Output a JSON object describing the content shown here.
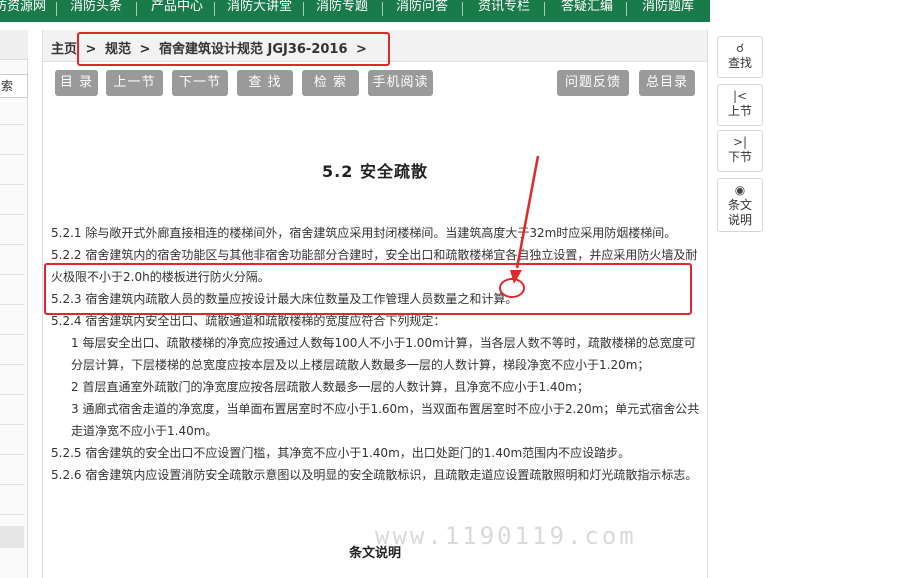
{
  "topnav": {
    "items": [
      "防资源网",
      "消防头条",
      "产品中心",
      "消防大讲堂",
      "消防专题",
      "消防问答",
      "资讯专栏",
      "答疑汇编",
      "消防题库"
    ]
  },
  "sidebar": {
    "search_fragment": "索"
  },
  "breadcrumb": {
    "home": "主页",
    "sep1": ">",
    "level1": "规范",
    "sep2": ">",
    "level2": "宿舍建筑设计规范 JGJ36-2016",
    "sep3": ">"
  },
  "toolbar": {
    "catalog": "目 录",
    "prev": "上一节",
    "next": "下一节",
    "find": "查 找",
    "search": "检 索",
    "mobile": "手机阅读",
    "feedback": "问题反馈",
    "all_catalog": "总目录"
  },
  "article": {
    "title": "5.2  安全疏散",
    "paragraphs": [
      "5.2.1 除与敞开式外廊直接相连的楼梯间外，宿舍建筑应采用封闭楼梯间。当建筑高度大于32m时应采用防烟楼梯间。",
      "5.2.2 宿舍建筑内的宿舍功能区与其他非宿舍功能部分合建时，安全出口和疏散楼梯宜各自独立设置，并应采用防火墙及耐火极限不小于2.0h的楼板进行防火分隔。",
      "5.2.3 宿舍建筑内疏散人员的数量应按设计最大床位数量及工作管理人员数量之和计算。",
      "5.2.4 宿舍建筑内安全出口、疏散通道和疏散楼梯的宽度应符合下列规定：",
      "1 每层安全出口、疏散楼梯的净宽应按通过人数每100人不小于1.00m计算，当各层人数不等时，疏散楼梯的总宽度可分层计算，下层楼梯的总宽度应按本层及以上楼层疏散人数最多一层的人数计算，梯段净宽不应小于1.20m；",
      "2 首层直通室外疏散门的净宽度应按各层疏散人数最多一层的人数计算，且净宽不应小于1.40m；",
      "3 通廊式宿舍走道的净宽度，当单面布置居室时不应小于1.60m，当双面布置居室时不应小于2.20m；单元式宿舍公共走道净宽不应小于1.40m。",
      "5.2.5 宿舍建筑的安全出口不应设置门槛，其净宽不应小于1.40m，出口处距门的1.40m范围内不应设踏步。",
      "5.2.6 宿舍建筑内应设置消防安全疏散示意图以及明显的安全疏散标识，且疏散走道应设置疏散照明和灯光疏散指示标志。"
    ],
    "explain_heading": "条文说明",
    "watermark": "www.1190119.com"
  },
  "tools": {
    "find": {
      "icon": "search-icon",
      "label": "查找"
    },
    "prev": {
      "icon": "prev-icon",
      "label": "上节"
    },
    "next": {
      "icon": "next-icon",
      "label": "下节"
    },
    "explain": {
      "icon": "eye-icon",
      "label1": "条文",
      "label2": "说明"
    }
  },
  "colors": {
    "nav_green": "#1a7b4a",
    "button_gray": "#9a9a9a",
    "annotation_red": "#e0282c"
  }
}
